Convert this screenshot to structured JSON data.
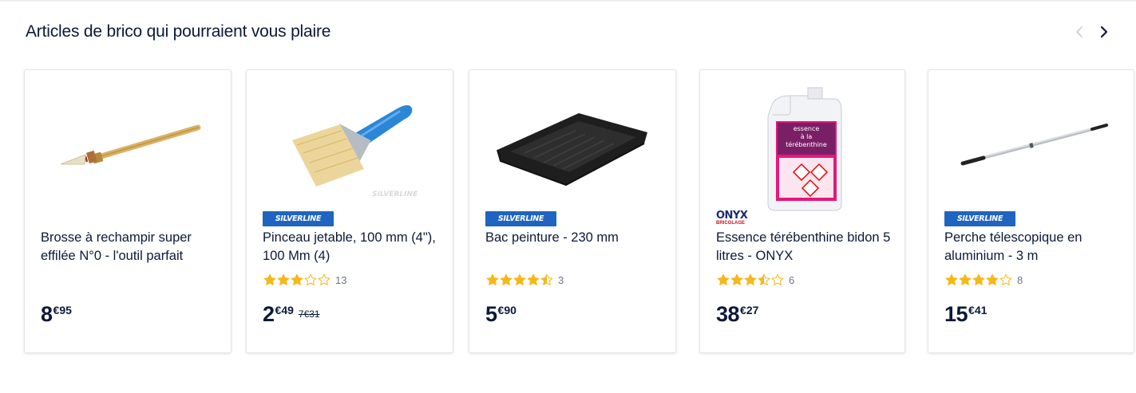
{
  "section": {
    "title": "Articles de brico qui pourraient vous plaire"
  },
  "carousel": {
    "prev_icon": "chevron-left-icon",
    "next_icon": "chevron-right-icon"
  },
  "colors": {
    "text": "#0c193a",
    "star": "#f6b81a",
    "star_empty": "#f6b81a",
    "silverline_blue": "#1f64c0"
  },
  "products": [
    {
      "title": "Brosse à rechampir super effilée N°0 - l'outil parfait",
      "brand": "",
      "rating": null,
      "rating_count": "",
      "price_int": "8",
      "price_dec": "€95",
      "price_old": ""
    },
    {
      "title": "Pinceau jetable, 100 mm (4\"), 100 Mm (4)",
      "brand": "SILVERLINE",
      "rating": 3,
      "rating_count": "13",
      "price_int": "2",
      "price_dec": "€49",
      "price_old": "7€31"
    },
    {
      "title": "Bac peinture - 230 mm",
      "brand": "SILVERLINE",
      "rating": 4.5,
      "rating_count": "3",
      "price_int": "5",
      "price_dec": "€90",
      "price_old": ""
    },
    {
      "title": "Essence térébenthine bidon 5 litres - ONYX",
      "brand": "ONYX",
      "brand_sub": "BRICOLAGE",
      "rating": 3.5,
      "rating_count": "6",
      "price_int": "38",
      "price_dec": "€27",
      "price_old": ""
    },
    {
      "title": "Perche télescopique en aluminium - 3 m",
      "brand": "SILVERLINE",
      "rating": 4,
      "rating_count": "8",
      "price_int": "15",
      "price_dec": "€41",
      "price_old": ""
    }
  ]
}
